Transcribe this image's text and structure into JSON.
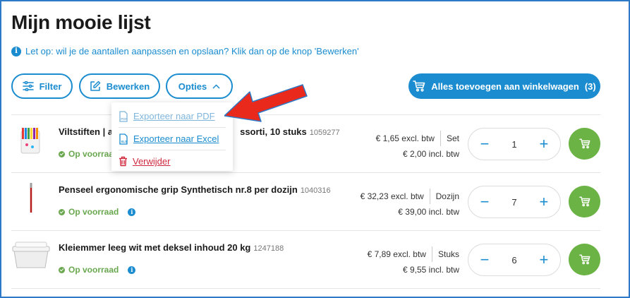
{
  "page": {
    "title": "Mijn mooie lijst"
  },
  "notice": {
    "text": "Let op: wil je de aantallen aanpassen en opslaan? Klik dan op de knop 'Bewerken'"
  },
  "toolbar": {
    "filter_label": "Filter",
    "edit_label": "Bewerken",
    "options_label": "Opties",
    "add_all_label": "Alles toevoegen aan winkelwagen",
    "add_all_count": "(3)"
  },
  "options_menu": {
    "items": [
      {
        "label": "Exporteer naar PDF",
        "icon": "pdf-file-icon"
      },
      {
        "label": "Exporteer naar Excel",
        "icon": "xls-file-icon"
      },
      {
        "label": "Verwijder",
        "icon": "trash-icon"
      }
    ]
  },
  "products": [
    {
      "name_start": "Viltstiften | a",
      "name_end": "ssorti, 10 stuks",
      "sku": "1059277",
      "stock": "Op voorraad",
      "price_excl": "€ 1,65 excl. btw",
      "unit": "Set",
      "price_incl": "€ 2,00 incl. btw",
      "quantity": "1"
    },
    {
      "name": "Penseel ergonomische grip Synthetisch nr.8 per dozijn",
      "sku": "1040316",
      "stock": "Op voorraad",
      "price_excl": "€ 32,23 excl. btw",
      "unit": "Dozijn",
      "price_incl": "€ 39,00 incl. btw",
      "quantity": "7"
    },
    {
      "name": "Kleiemmer leeg wit met deksel inhoud 20 kg",
      "sku": "1247188",
      "stock": "Op voorraad",
      "price_excl": "€ 7,89 excl. btw",
      "unit": "Stuks",
      "price_incl": "€ 9,55 incl. btw",
      "quantity": "6"
    }
  ],
  "colors": {
    "accent": "#1a8ccf",
    "in_stock": "#6aa84f",
    "cart_green": "#6ab344",
    "delete_red": "#d0283e",
    "annotation_arrow": "#e8291c"
  }
}
